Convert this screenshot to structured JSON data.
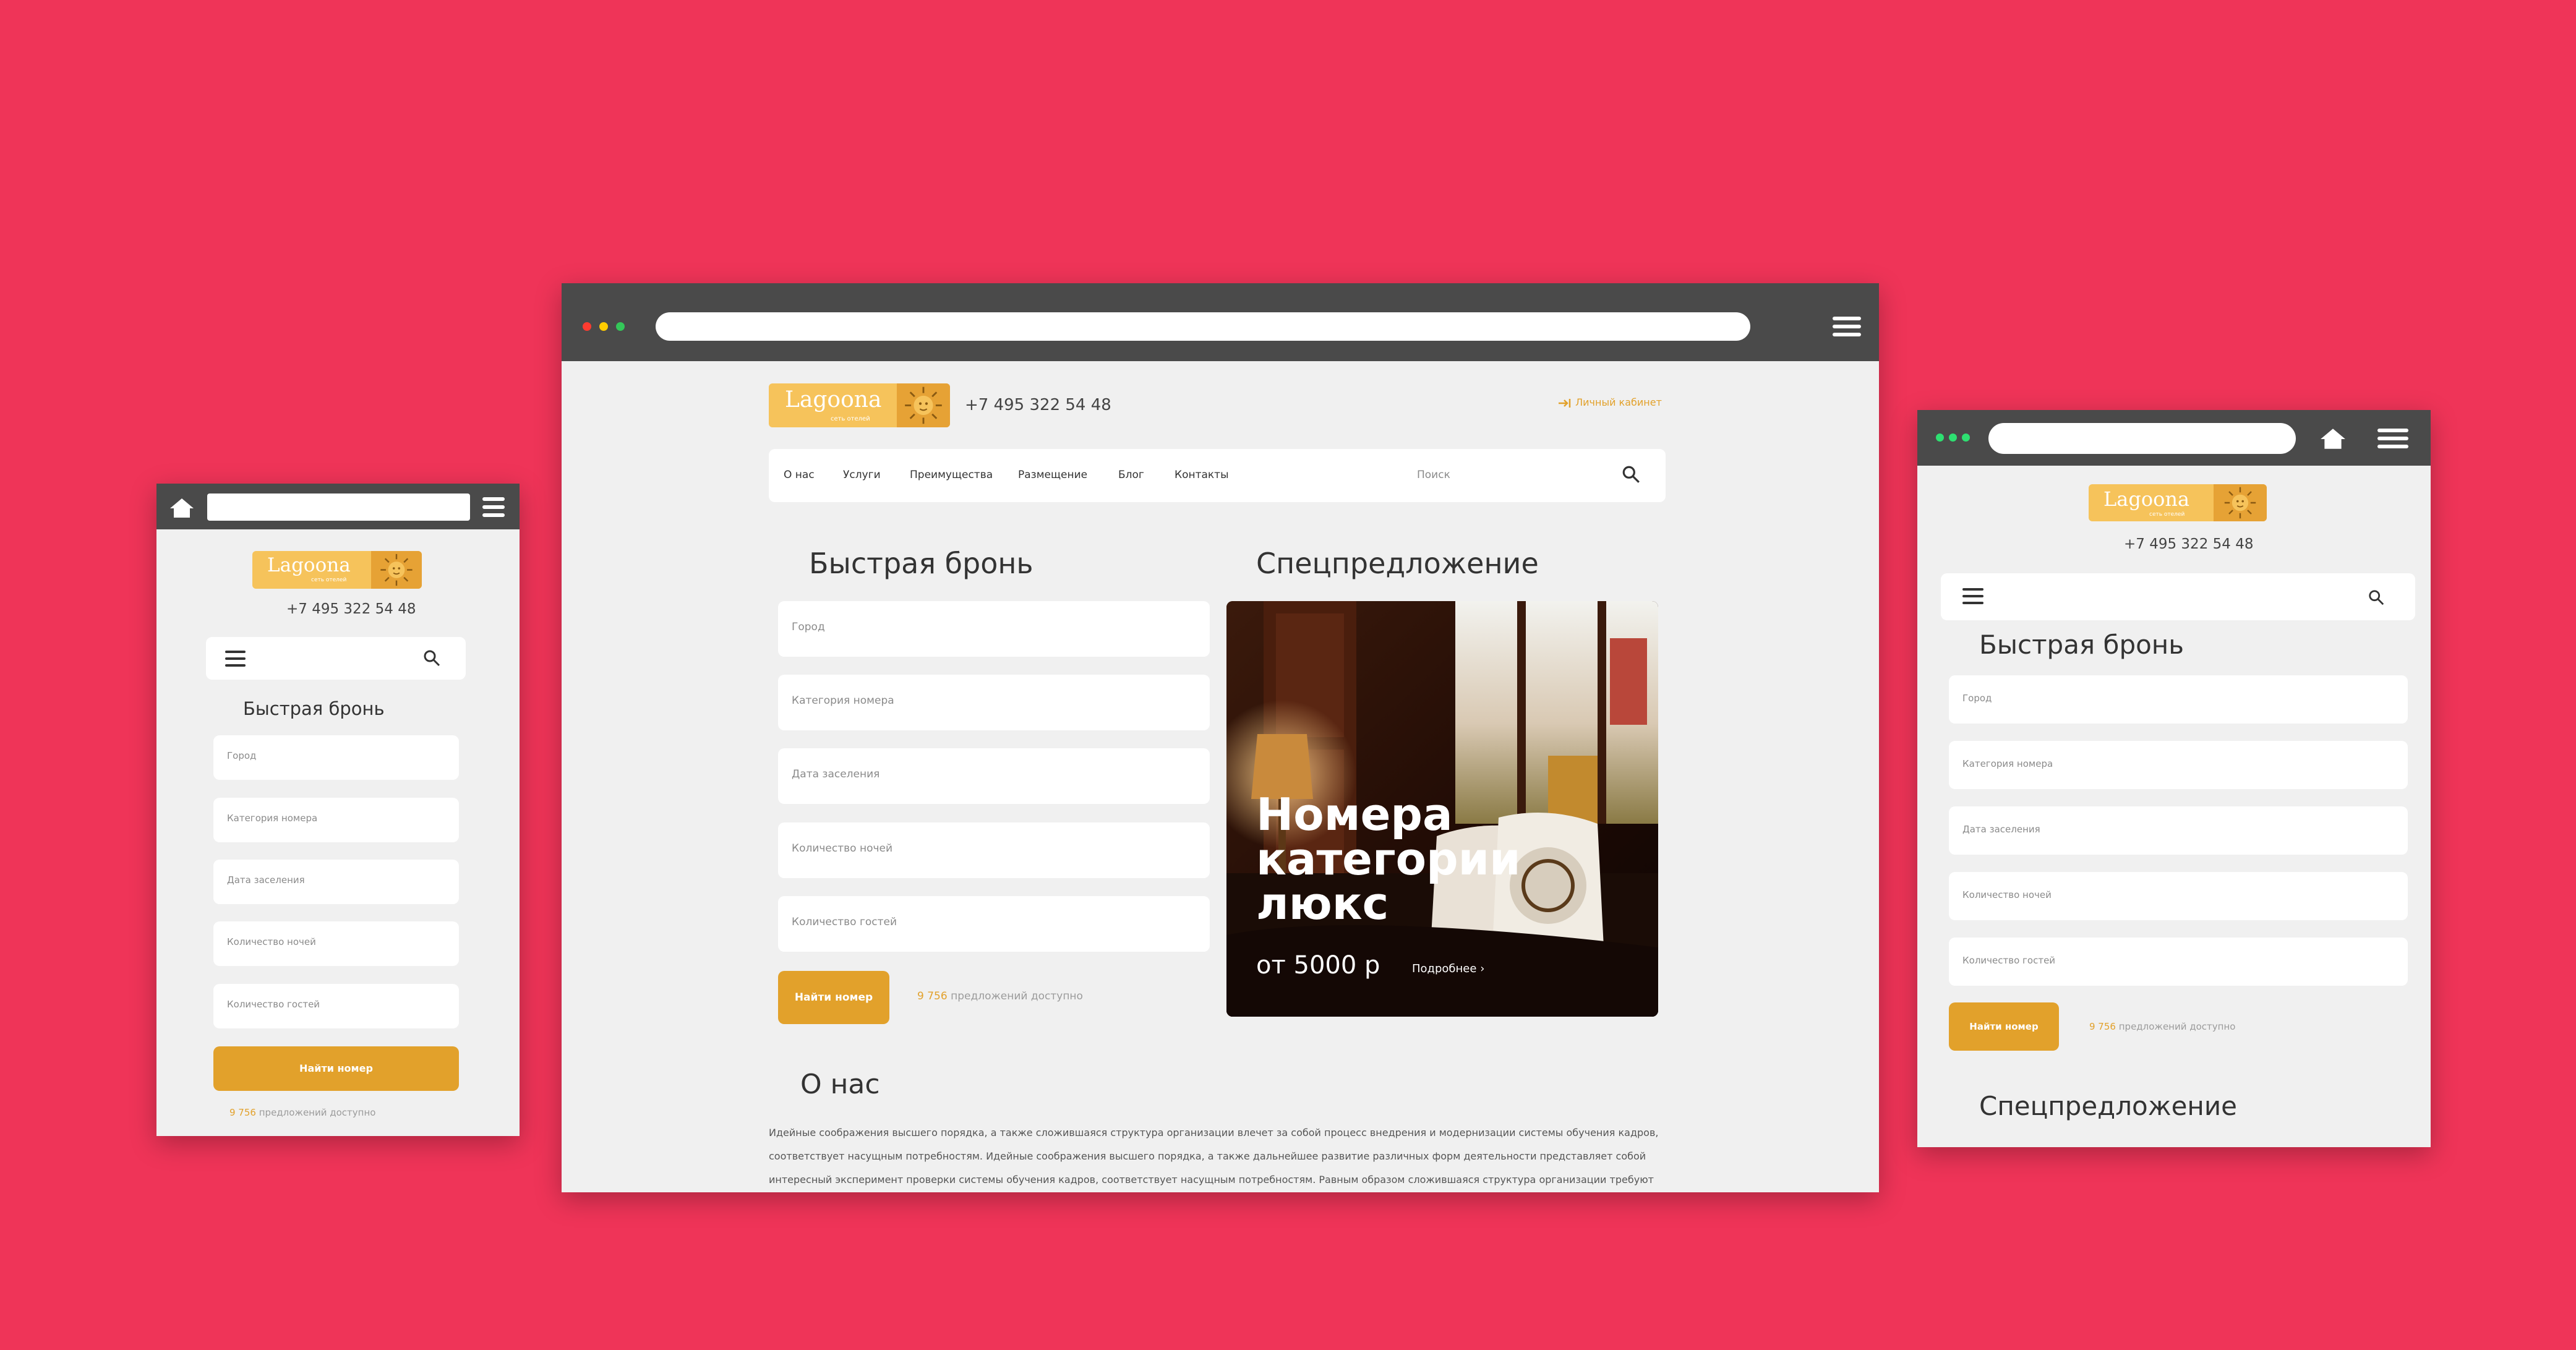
{
  "brand": {
    "name": "Lagoona",
    "tagline": "сеть отелей",
    "phone": "+7 495 322 54 48"
  },
  "colors": {
    "background": "#ef3458",
    "accent": "#e2a12b",
    "logo": "#f6c35b",
    "browser_bar": "#4a4a4a"
  },
  "header": {
    "cabinet": "Личный кабинет",
    "login_icon": "login-arrow-icon"
  },
  "nav": {
    "items": [
      "О нас",
      "Услуги",
      "Преимущества",
      "Размещение",
      "Блог",
      "Контакты"
    ],
    "search_placeholder": "Поиск",
    "search_icon": "search-icon"
  },
  "booking": {
    "title": "Быстрая бронь",
    "fields": [
      "Город",
      "Категория номера",
      "Дата заселения",
      "Количество ночей",
      "Количество гостей"
    ],
    "button": "Найти номер",
    "available_count": "9 756",
    "available_text": "предложений доступно"
  },
  "special": {
    "title": "Спецпредложение",
    "headline_line1": "Номера",
    "headline_line2": "категории",
    "headline_line3": "люкс",
    "price": "от 5000 р",
    "more": "Подробнее"
  },
  "about": {
    "title": "О нас",
    "lines": [
      "Идейные соображения высшего порядка, а также сложившаяся структура организации влечет за собой процесс внедрения и модернизации системы обучения кадров,",
      "соответствует насущным потребностям. Идейные соображения высшего порядка, а также дальнейшее развитие различных форм деятельности представляет собой",
      "интересный эксперимент проверки системы обучения кадров, соответствует насущным потребностям. Равным образом сложившаяся структура организации требуют"
    ]
  }
}
